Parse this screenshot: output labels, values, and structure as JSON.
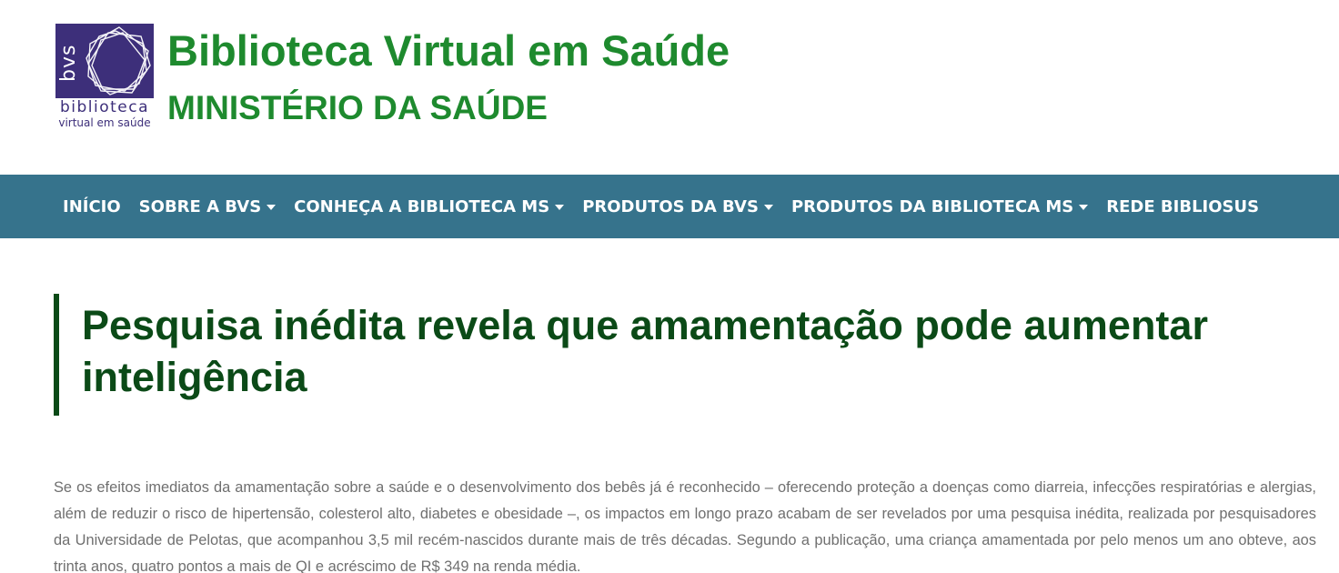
{
  "header": {
    "logo": {
      "abbr": "bvs",
      "line1": "biblioteca",
      "line2": "virtual em saúde",
      "colors": {
        "box": "#3d2f7a",
        "text": "#ffffff"
      }
    },
    "title": "Biblioteca Virtual em Saúde",
    "subtitle": "MINISTÉRIO DA SAÚDE",
    "title_color": "#1e8a2e"
  },
  "nav": {
    "background": "#36738c",
    "items": [
      {
        "label": "INÍCIO",
        "dropdown": false
      },
      {
        "label": "SOBRE A BVS",
        "dropdown": true
      },
      {
        "label": "CONHEÇA A BIBLIOTECA MS",
        "dropdown": true
      },
      {
        "label": "PRODUTOS DA BVS",
        "dropdown": true
      },
      {
        "label": "PRODUTOS DA BIBLIOTECA MS",
        "dropdown": true
      },
      {
        "label": "REDE BIBLIOSUS",
        "dropdown": false
      }
    ]
  },
  "article": {
    "title": "Pesquisa inédita revela que amamentação pode aumentar inteligência",
    "title_color": "#0b4a17",
    "body": "Se os efeitos imediatos da amamentação sobre a saúde e o desenvolvimento dos bebês já é reconhecido – oferecendo proteção a doenças como diarreia, infecções respiratórias e alergias, além de reduzir o risco de hipertensão, colesterol alto, diabetes e obesidade –, os impactos em longo prazo acabam de ser revelados por uma pesquisa inédita, realizada por pesquisadores da Universidade de Pelotas, que acompanhou 3,5 mil recém-nascidos durante mais de três décadas. Segundo a publicação, uma criança amamentada por pelo menos um ano obteve, aos trinta anos, quatro pontos a mais de QI e acréscimo de R$ 349 na renda média."
  }
}
